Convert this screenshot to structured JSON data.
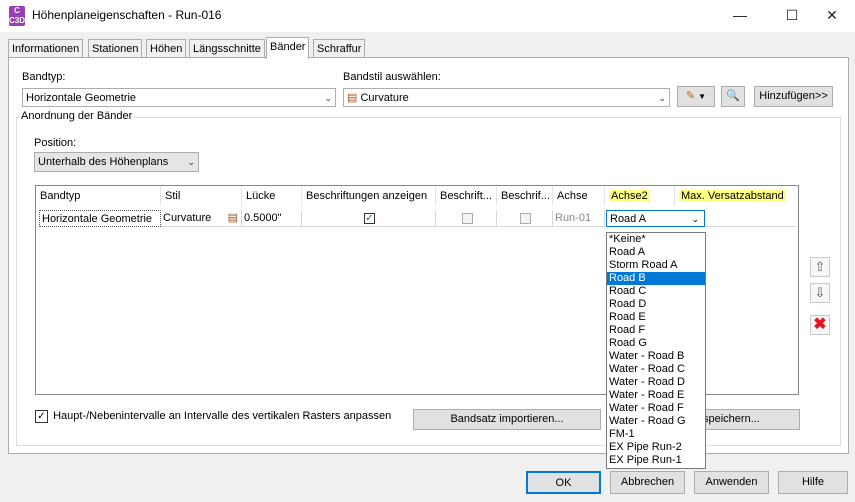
{
  "window": {
    "title": "Höhenplaneigenschaften - Run-016",
    "icon_text": "C\nC3D",
    "minimize": "—",
    "maximize": "☐",
    "close": "✕"
  },
  "tabs": [
    {
      "label": "Informationen"
    },
    {
      "label": "Stationen"
    },
    {
      "label": "Höhen"
    },
    {
      "label": "Längsschnitte"
    },
    {
      "label": "Bänder",
      "active": true
    },
    {
      "label": "Schraffur"
    }
  ],
  "form": {
    "bandtyp_label": "Bandtyp:",
    "bandtyp_value": "Horizontale Geometrie",
    "bandstil_label": "Bandstil auswählen:",
    "bandstil_value": "Curvature",
    "add_button": "Hinzufügen>>",
    "group_title": "Anordnung der Bänder",
    "position_label": "Position:",
    "position_value": "Unterhalb des Höhenplans"
  },
  "grid": {
    "headers": [
      "Bandtyp",
      "Stil",
      "Lücke",
      "Beschriftungen anzeigen",
      "Beschrift...",
      "Beschrif...",
      "Achse",
      "Achse2",
      "Max. Versatzabstand"
    ],
    "row": {
      "bandtyp": "Horizontale Geometrie",
      "stil": "Curvature",
      "luecke": "0.5000\"",
      "beschriftungen_anzeigen": true,
      "beschrift1": false,
      "beschrift2": false,
      "achse": "Run-01",
      "achse2": "Road A"
    }
  },
  "dropdown": {
    "selected": "Road B",
    "options": [
      "*Keine*",
      "Road A",
      "Storm Road A",
      "Road B",
      "Road C",
      "Road D",
      "Road E",
      "Road F",
      "Road G",
      "Water - Road B",
      "Water - Road C",
      "Water - Road D",
      "Water - Road E",
      "Water - Road F",
      "Water - Road G",
      "FM-1",
      "EX Pipe Run-2",
      "EX Pipe Run-1"
    ]
  },
  "bottom": {
    "checkbox_label": "Haupt-/Nebenintervalle an Intervalle des vertikalen Rasters anpassen",
    "checkbox_checked": true,
    "import_button": "Bandsatz importieren...",
    "save_button": "speichern..."
  },
  "footer": {
    "ok": "OK",
    "cancel": "Abbrechen",
    "apply": "Anwenden",
    "help": "Hilfe"
  },
  "colors": {
    "highlight_header": "#ffff80",
    "selection": "#0078d7",
    "delete_red": "#e81123"
  }
}
